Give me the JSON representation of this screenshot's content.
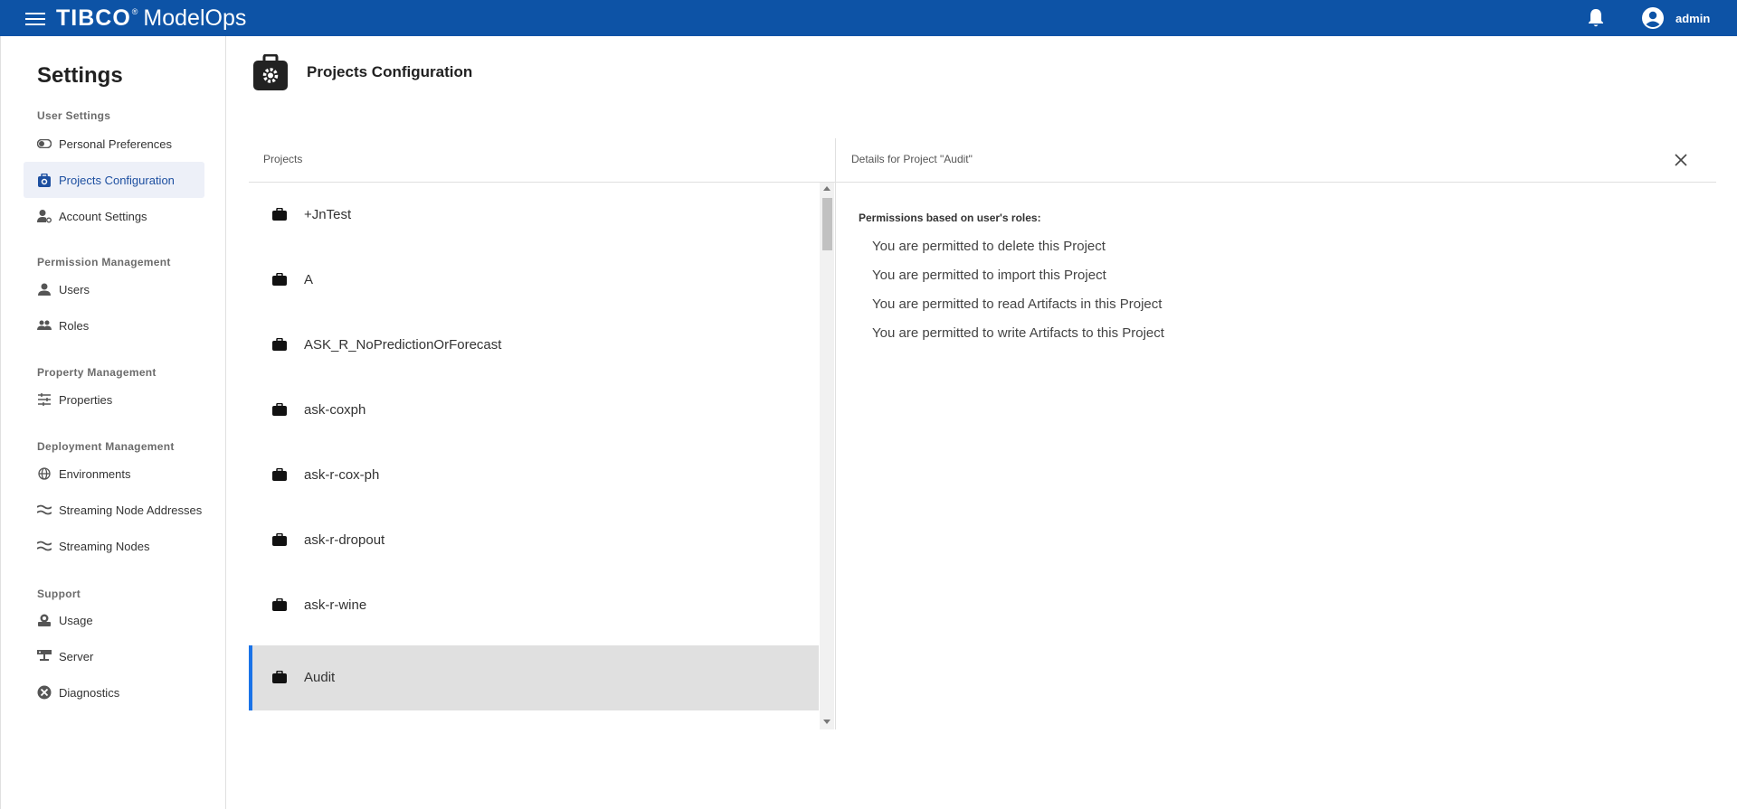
{
  "header": {
    "brand": "TIBCO",
    "brand_mark": "®",
    "product": "ModelOps",
    "user": "admin"
  },
  "sidebar": {
    "title": "Settings",
    "sections": [
      {
        "label": "User Settings",
        "items": [
          "Personal Preferences",
          "Projects Configuration",
          "Account Settings"
        ]
      },
      {
        "label": "Permission Management",
        "items": [
          "Users",
          "Roles"
        ]
      },
      {
        "label": "Property Management",
        "items": [
          "Properties"
        ]
      },
      {
        "label": "Deployment Management",
        "items": [
          "Environments",
          "Streaming Node Addresses",
          "Streaming Nodes"
        ]
      },
      {
        "label": "Support",
        "items": [
          "Usage",
          "Server",
          "Diagnostics"
        ]
      }
    ],
    "active_item": "Projects Configuration"
  },
  "page": {
    "title": "Projects Configuration"
  },
  "projects": {
    "header": "Projects",
    "items": [
      "+JnTest",
      "A",
      "ASK_R_NoPredictionOrForecast",
      "ask-coxph",
      "ask-r-cox-ph",
      "ask-r-dropout",
      "ask-r-wine",
      "Audit"
    ],
    "selected": "Audit"
  },
  "details": {
    "header": "Details for Project \"Audit\"",
    "permissions_title": "Permissions based on user's roles:",
    "permissions": [
      "You are permitted to delete this Project",
      "You are permitted to import this Project",
      "You are permitted to read Artifacts in this Project",
      "You are permitted to write Artifacts to this Project"
    ]
  },
  "colors": {
    "topbar": "#0d53a6",
    "accent": "#1a73e8",
    "selected_row": "#e0e0e0",
    "active_nav": "#edf0f8"
  }
}
